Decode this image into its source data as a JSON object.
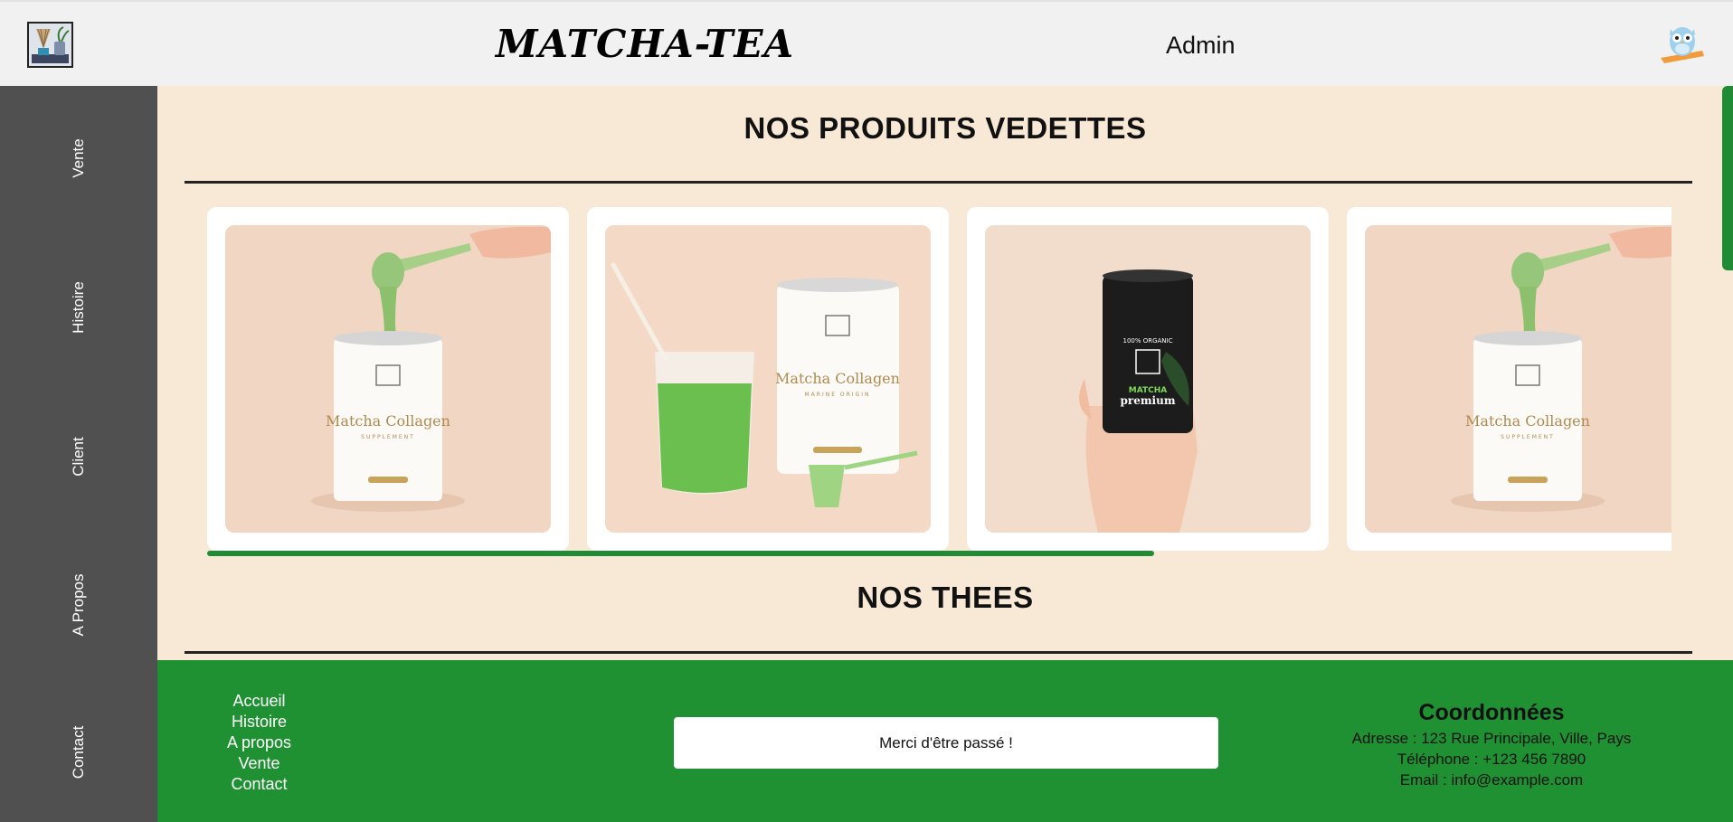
{
  "header": {
    "brand": "MATCHA-TEA",
    "admin_label": "Admin"
  },
  "sidebar": {
    "items": [
      {
        "label": "Vente"
      },
      {
        "label": "Histoire"
      },
      {
        "label": "Client"
      },
      {
        "label": "A Propos"
      },
      {
        "label": "Contact"
      }
    ]
  },
  "main": {
    "featured_title": "NOS PRODUITS VEDETTES",
    "teas_title": "NOS THEES",
    "carousel": {
      "progress_fraction": 0.647,
      "products": [
        {
          "image": "matcha-collagen-scoop",
          "can_text": "Matcha Collagen",
          "can_subtitle": "SUPPLEMENT"
        },
        {
          "image": "matcha-collagen-latte",
          "can_text": "Matcha Collagen",
          "can_subtitle": "MARINE ORIGIN"
        },
        {
          "image": "matcha-premium-black-tin",
          "can_text": "MATCHA premium",
          "can_subtitle": "100% ORGANIC"
        },
        {
          "image": "matcha-collagen-scoop",
          "can_text": "Matcha Collagen",
          "can_subtitle": "SUPPLEMENT"
        }
      ]
    }
  },
  "footer": {
    "links": [
      "Accueil",
      "Histoire",
      "A propos",
      "Vente",
      "Contact"
    ],
    "thanks_message": "Merci d'être passé !",
    "contact": {
      "title": "Coordonnées",
      "address": "Adresse : 123 Rue Principale, Ville, Pays",
      "phone": "Téléphone : +123 456 7890",
      "email": "Email : info@example.com"
    }
  },
  "colors": {
    "sidebar": "#505050",
    "main_bg": "#f8e9d6",
    "accent_green": "#1f8b35",
    "header_bg": "#f1f1f1"
  }
}
